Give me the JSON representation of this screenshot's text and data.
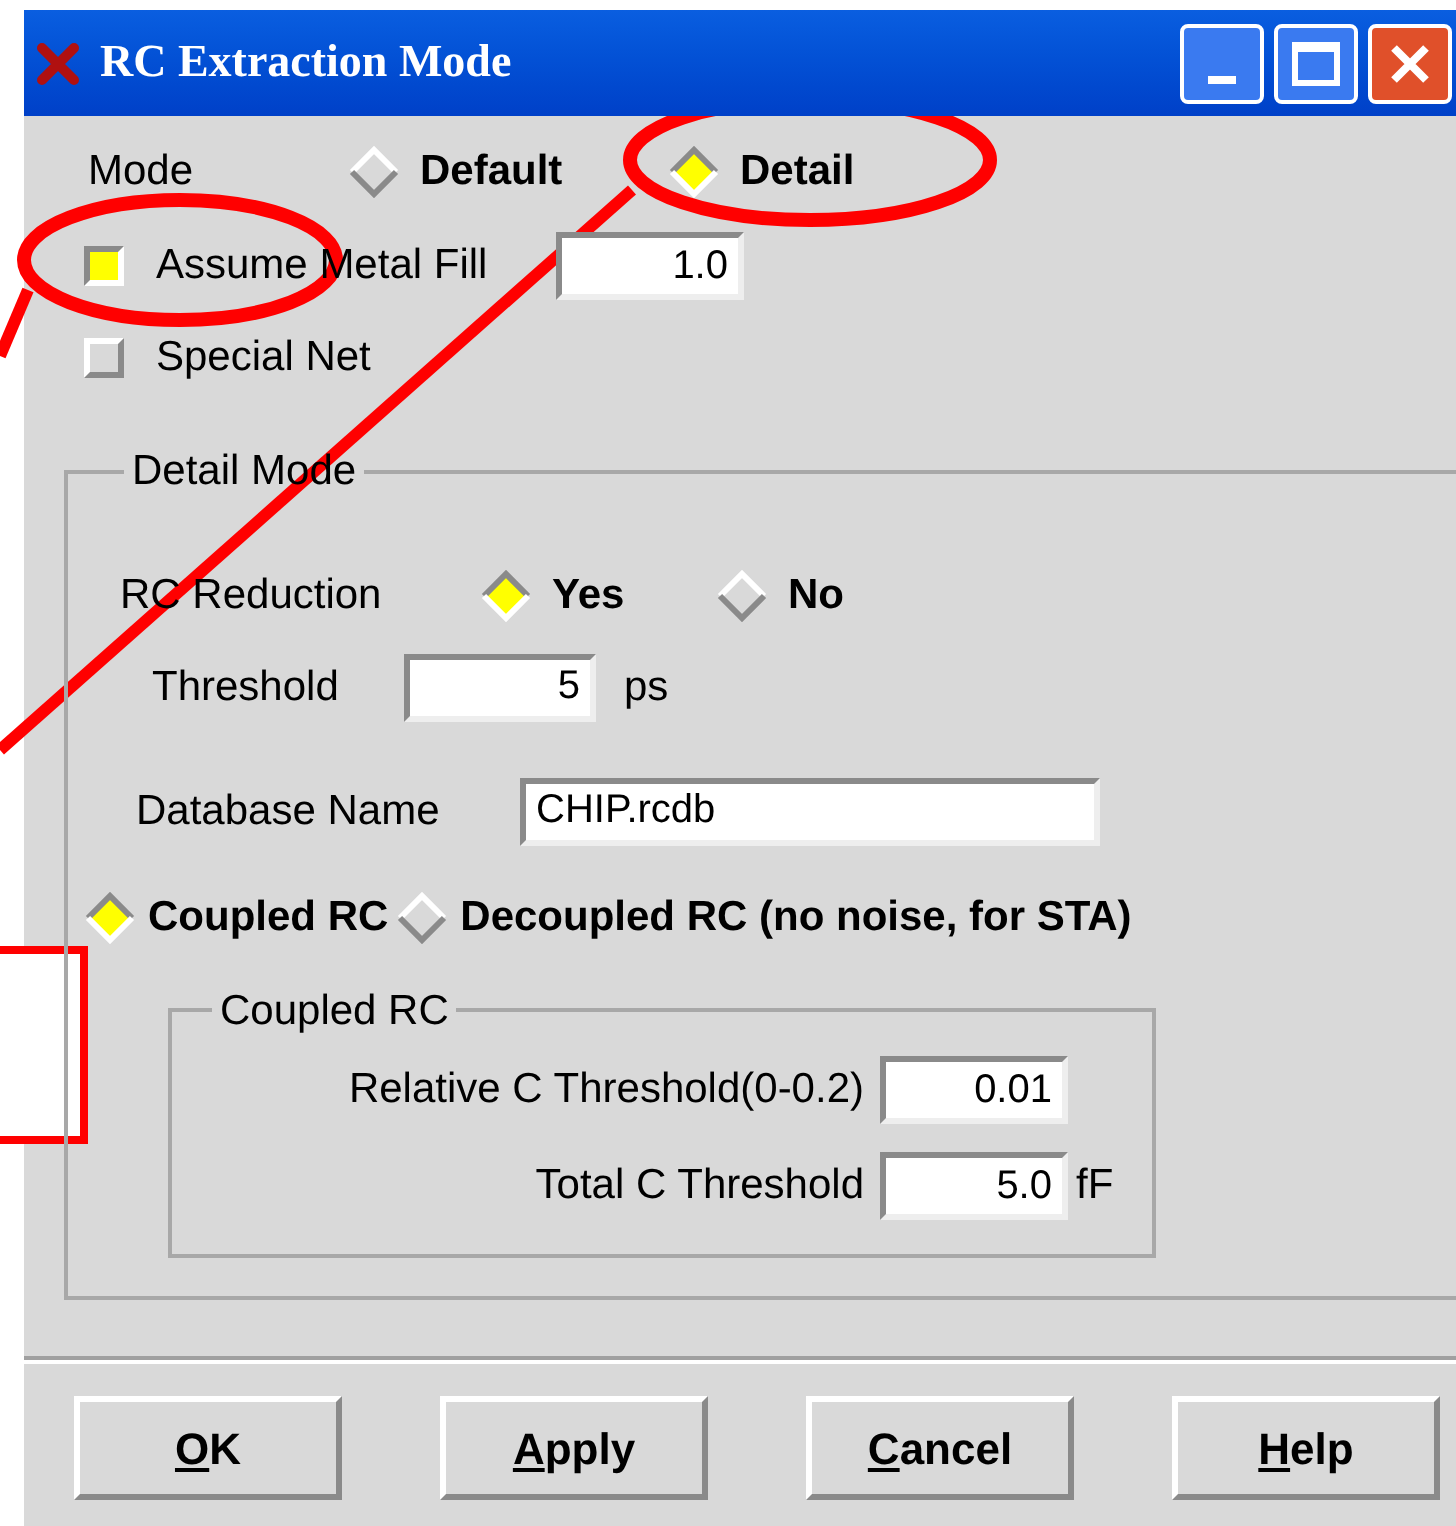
{
  "window": {
    "title": "RC Extraction Mode"
  },
  "mode": {
    "label": "Mode",
    "options": [
      {
        "label": "Default",
        "selected": false
      },
      {
        "label": "Detail",
        "selected": true
      }
    ]
  },
  "checkboxes": [
    {
      "label": "Assume Metal Fill",
      "checked": true,
      "value": "1.0"
    },
    {
      "label": "Special Net",
      "checked": false
    }
  ],
  "detail_mode": {
    "title": "Detail Mode",
    "rc_reduction": {
      "label": "RC Reduction",
      "options": [
        {
          "label": "Yes",
          "selected": true
        },
        {
          "label": "No",
          "selected": false
        }
      ]
    },
    "threshold": {
      "label": "Threshold",
      "value": "5",
      "unit": "ps"
    },
    "database_name": {
      "label": "Database Name",
      "value": "CHIP.rcdb"
    },
    "rc_type": [
      {
        "label": "Coupled RC",
        "selected": true
      },
      {
        "label": "Decoupled RC (no noise, for STA)",
        "selected": false
      }
    ],
    "coupled_rc": {
      "title": "Coupled RC",
      "fields": [
        {
          "label": "Relative C Threshold(0-0.2)",
          "value": "0.01"
        },
        {
          "label": "Total C Threshold",
          "value": "5.0",
          "unit": "fF"
        }
      ]
    }
  },
  "buttons": [
    {
      "mnemonic": "O",
      "rest": "K"
    },
    {
      "mnemonic": "A",
      "rest": "pply"
    },
    {
      "mnemonic": "C",
      "rest": "ancel"
    },
    {
      "mnemonic": "H",
      "rest": "elp"
    }
  ]
}
